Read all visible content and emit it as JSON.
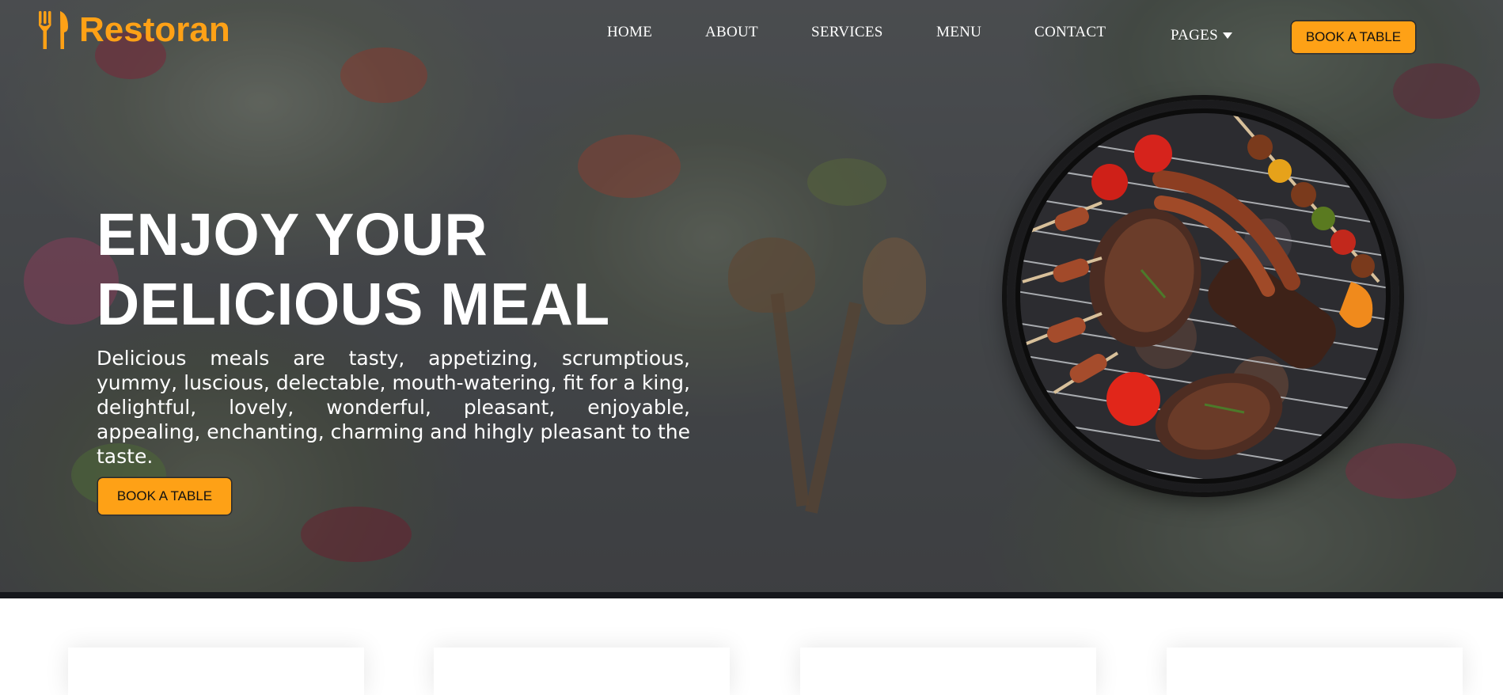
{
  "brand": {
    "name": "Restoran",
    "icon": "utensils-icon",
    "color": "#fea116"
  },
  "nav": {
    "items": [
      "HOME",
      "ABOUT",
      "SERVICES",
      "MENU",
      "CONTACT"
    ],
    "pages_label": "PAGES",
    "book_button": "BOOK A TABLE"
  },
  "hero": {
    "headline_line1": "ENJOY YOUR",
    "headline_line2": "DELICIOUS MEAL",
    "description": "Delicious meals are tasty, appetizing, scrumptious, yummy, luscious, delectable, mouth-watering, fit for a king, delightful, lovely, wonderful, pleasant, enjoyable, appealing, enchanting, charming and hihgly pleasant to the taste.",
    "button": "BOOK A TABLE",
    "image": "grill-image"
  },
  "colors": {
    "accent": "#fea116",
    "overlay": "#15171b",
    "text": "#ffffff"
  }
}
